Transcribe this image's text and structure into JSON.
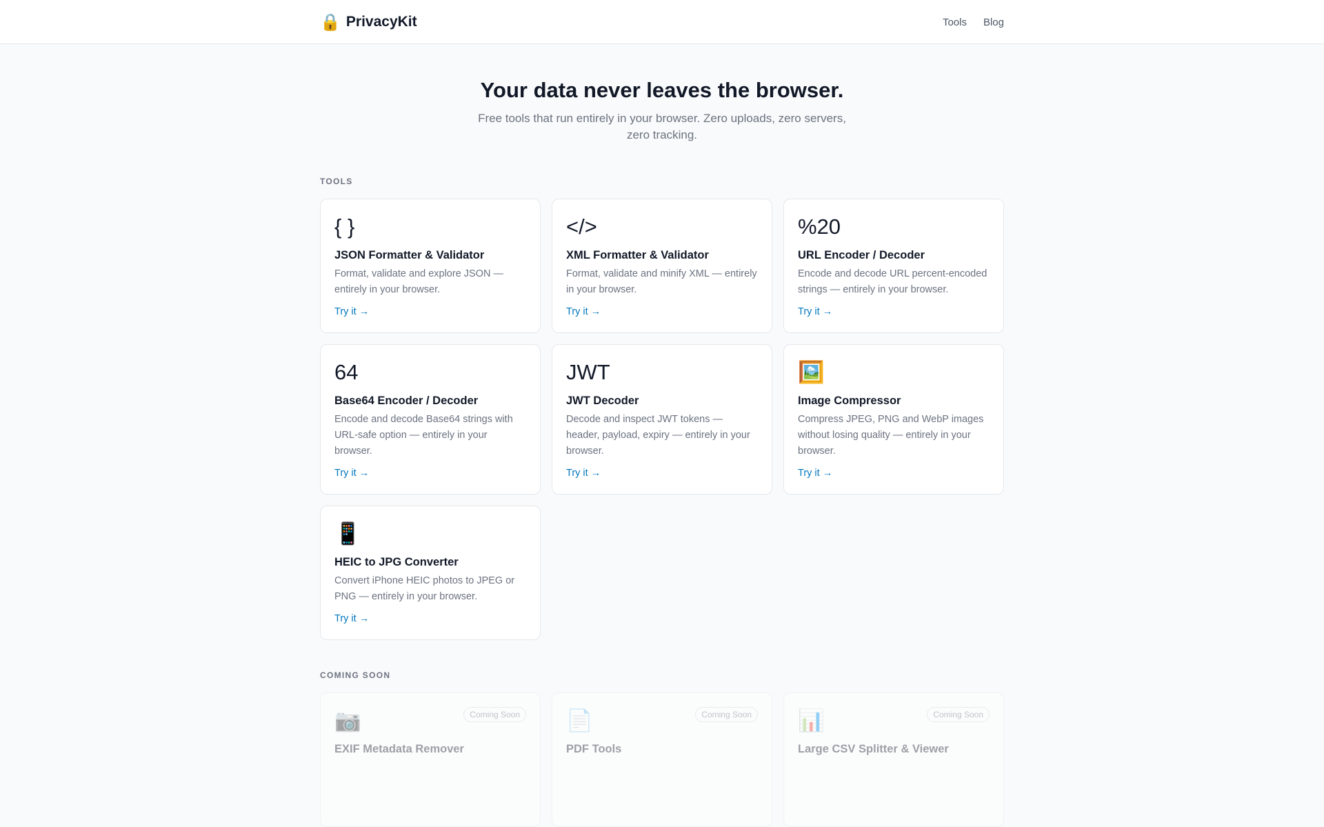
{
  "header": {
    "logo_icon": "🔒",
    "brand": "PrivacyKit",
    "nav": [
      "Tools",
      "Blog"
    ]
  },
  "hero": {
    "title": "Your data never leaves the browser.",
    "subtitle": "Free tools that run entirely in your browser. Zero uploads, zero servers, zero tracking."
  },
  "tools_label": "TOOLS",
  "tools": [
    {
      "icon": "{ }",
      "title": "JSON Formatter & Validator",
      "desc": "Format, validate and explore JSON — entirely in your browser.",
      "link": "Try it →"
    },
    {
      "icon": "</>",
      "title": "XML Formatter & Validator",
      "desc": "Format, validate and minify XML — entirely in your browser.",
      "link": "Try it →"
    },
    {
      "icon": "%20",
      "title": "URL Encoder / Decoder",
      "desc": "Encode and decode URL percent-encoded strings — entirely in your browser.",
      "link": "Try it →"
    },
    {
      "icon": "64",
      "title": "Base64 Encoder / Decoder",
      "desc": "Encode and decode Base64 strings with URL-safe option — entirely in your browser.",
      "link": "Try it →"
    },
    {
      "icon": "JWT",
      "title": "JWT Decoder",
      "desc": "Decode and inspect JWT tokens — header, payload, expiry — entirely in your browser.",
      "link": "Try it →"
    },
    {
      "icon": "🖼️",
      "title": "Image Compressor",
      "desc": "Compress JPEG, PNG and WebP images without losing quality — entirely in your browser.",
      "link": "Try it →"
    },
    {
      "icon": "📱",
      "title": "HEIC to JPG Converter",
      "desc": "Convert iPhone HEIC photos to JPEG or PNG — entirely in your browser.",
      "link": "Try it →"
    }
  ],
  "coming_label": "COMING SOON",
  "coming": [
    {
      "icon": "📷",
      "title": "EXIF Metadata Remover",
      "badge": "Coming Soon"
    },
    {
      "icon": "📄",
      "title": "PDF Tools",
      "badge": "Coming Soon"
    },
    {
      "icon": "📊",
      "title": "Large CSV Splitter & Viewer",
      "badge": "Coming Soon"
    }
  ]
}
